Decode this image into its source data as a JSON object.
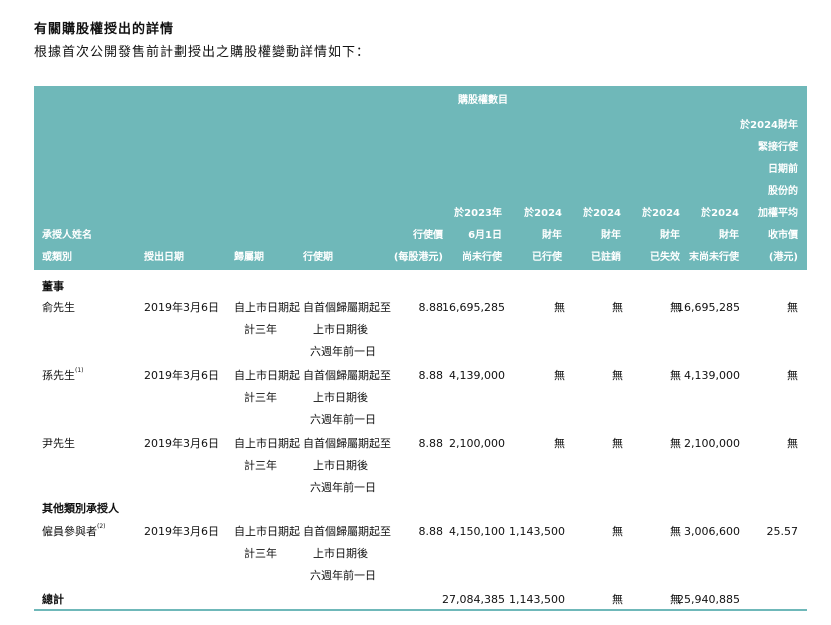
{
  "section": {
    "title": "有關購股權授出的詳情",
    "subtitle": "根據首次公開發售前計劃授出之購股權變動詳情如下："
  },
  "header": {
    "group_label": "購股權數目",
    "name_l1": "承授人姓名",
    "name_l2": "或類別",
    "grant_date": "授出日期",
    "vesting": "歸屬期",
    "exercise_period": "行使期",
    "price_l1": "行使價",
    "price_l2": "(每股港元)",
    "col_jun_l1": "於2023年",
    "col_jun_l2": "6月1日",
    "col_jun_l3": "尚未行使",
    "col_ex_l1": "於2024",
    "col_ex_l2": "財年",
    "col_ex_l3": "已行使",
    "col_can_l1": "於2024",
    "col_can_l2": "財年",
    "col_can_l3": "已註銷",
    "col_lap_l1": "於2024",
    "col_lap_l2": "財年",
    "col_lap_l3": "已失效",
    "col_end_l1": "於2024",
    "col_end_l2": "財年",
    "col_end_l3": "末尚未行使",
    "wavg_lines": [
      "於2024財年",
      "緊接行使",
      "日期前",
      "股份的",
      "加權平均",
      "收市價",
      "(港元)"
    ]
  },
  "groups": {
    "directors": "董事",
    "others": "其他類別承授人"
  },
  "rows": [
    {
      "name": "俞先生",
      "note": "",
      "date": "2019年3月6日",
      "vest_l1": "自上市日期起",
      "vest_l2": "計三年",
      "ex_l1": "自首個歸屬期起至",
      "ex_l2": "上市日期後",
      "ex_l3": "六週年前一日",
      "price": "8.88",
      "outstanding_start": "16,695,285",
      "exercised": "無",
      "cancelled": "無",
      "lapsed": "無",
      "outstanding_end": "16,695,285",
      "wavg": "無"
    },
    {
      "name": "孫先生",
      "note": "(1)",
      "date": "2019年3月6日",
      "vest_l1": "自上市日期起",
      "vest_l2": "計三年",
      "ex_l1": "自首個歸屬期起至",
      "ex_l2": "上市日期後",
      "ex_l3": "六週年前一日",
      "price": "8.88",
      "outstanding_start": "4,139,000",
      "exercised": "無",
      "cancelled": "無",
      "lapsed": "無",
      "outstanding_end": "4,139,000",
      "wavg": "無"
    },
    {
      "name": "尹先生",
      "note": "",
      "date": "2019年3月6日",
      "vest_l1": "自上市日期起",
      "vest_l2": "計三年",
      "ex_l1": "自首個歸屬期起至",
      "ex_l2": "上市日期後",
      "ex_l3": "六週年前一日",
      "price": "8.88",
      "outstanding_start": "2,100,000",
      "exercised": "無",
      "cancelled": "無",
      "lapsed": "無",
      "outstanding_end": "2,100,000",
      "wavg": "無"
    },
    {
      "name": "僱員參與者",
      "note": "(2)",
      "date": "2019年3月6日",
      "vest_l1": "自上市日期起",
      "vest_l2": "計三年",
      "ex_l1": "自首個歸屬期起至",
      "ex_l2": "上市日期後",
      "ex_l3": "六週年前一日",
      "price": "8.88",
      "outstanding_start": "4,150,100",
      "exercised": "1,143,500",
      "cancelled": "無",
      "lapsed": "無",
      "outstanding_end": "3,006,600",
      "wavg": "25.57"
    }
  ],
  "total": {
    "label": "總計",
    "outstanding_start": "27,084,385",
    "exercised": "1,143,500",
    "cancelled": "無",
    "lapsed": "無",
    "outstanding_end": "25,940,885"
  },
  "colors": {
    "header_bg": "#6fb8b9",
    "header_text": "#ffffff"
  }
}
